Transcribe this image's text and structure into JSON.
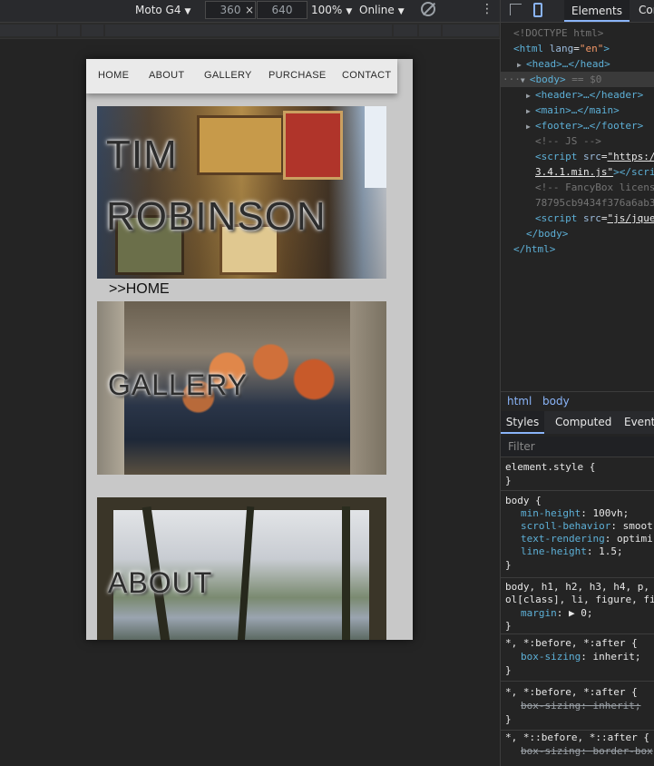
{
  "device_toolbar": {
    "device": "Moto G4",
    "width": "360",
    "times": "×",
    "height": "640",
    "zoom": "100%",
    "throttle": "Online",
    "rotate_icon": "rotate-icon",
    "more_icon": "kebab-icon",
    "more_glyph": "⋮",
    "caret": "▼"
  },
  "site": {
    "nav": [
      "HOME",
      "ABOUT",
      "GALLERY",
      "PURCHASE",
      "CONTACT"
    ],
    "hero_title_line1": "TIM",
    "hero_title_line2": "ROBINSON",
    "home_label": ">>HOME",
    "gallery_title": "GALLERY",
    "about_title": "ABOUT"
  },
  "devtools": {
    "tabs": {
      "elements": "Elements",
      "console": "Con"
    },
    "dom": {
      "doctype": "<!DOCTYPE html>",
      "html_open_tag": "<html",
      "html_attr": "lang",
      "html_attr_val": "\"en\"",
      "gt": ">",
      "head": "<head>…</head>",
      "body_open": "<body>",
      "body_sel": "== $0",
      "ellipsis": "···",
      "header": "<header>…</header>",
      "main": "<main>…</main>",
      "footer": "<footer>…</footer>",
      "comment_js": "<!-- JS -->",
      "script_open": "<script",
      "script_attr": "src",
      "script_src1": "\"https:/",
      "script_src1b": "3.4.1.min.js\"",
      "script_close1": "></scri",
      "comment_fancybox": "<!-- FancyBox licens",
      "comment_hash": "78795cb9434f376a6ab3",
      "script_src2": "\"js/jque",
      "body_close": "</body>",
      "html_close": "</html>"
    },
    "breadcrumbs": [
      "html",
      "body"
    ],
    "style_tabs": [
      "Styles",
      "Computed",
      "Event l"
    ],
    "filter_placeholder": "Filter",
    "rules": {
      "element_style": "element.style {",
      "close": "}",
      "body_sel": "body {",
      "body_props": [
        {
          "name": "min-height",
          "value": "100vh;"
        },
        {
          "name": "scroll-behavior",
          "value": "smoot"
        },
        {
          "name": "text-rendering",
          "value": "optimi"
        },
        {
          "name": "line-height",
          "value": "1.5;"
        }
      ],
      "reset_sel1": "body, h1, h2, h3, h4, p,",
      "reset_sel2": "ol[class], li, figure, fi",
      "reset_prop": {
        "name": "margin",
        "value": "▶ 0;"
      },
      "star_sel1": "*, *:before, *:after {",
      "star_prop1": {
        "name": "box-sizing",
        "value": "inherit;"
      },
      "star_sel2": "*, *:before, *:after {",
      "star_prop2": {
        "name": "box-sizing",
        "value": "inherit;"
      },
      "star_sel3": "*, *::before, *::after {",
      "star_prop3": {
        "name": "box-sizing",
        "value": "border-box"
      }
    }
  }
}
